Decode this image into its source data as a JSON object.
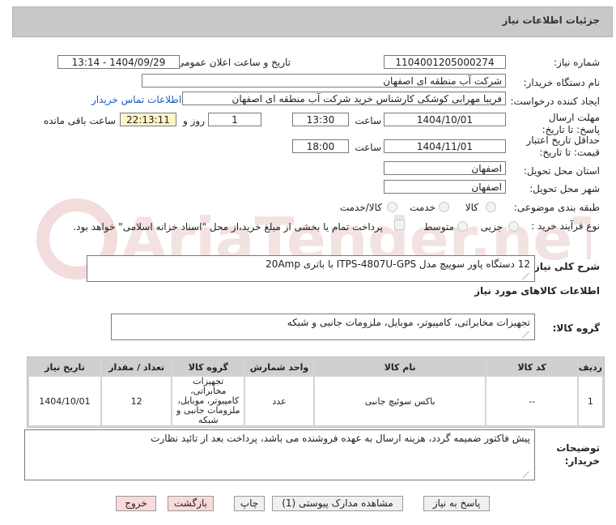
{
  "header": {
    "title": "جزئیات اطلاعات نیاز"
  },
  "fields": {
    "need_number_label": "شماره نیاز:",
    "need_number": "1104001205000274",
    "announce_label": "تاریخ و ساعت اعلان عمومی:",
    "announce_value": "1404/09/29 - 13:14",
    "buyer_org_label": "نام دستگاه خریدار:",
    "buyer_org": "شرکت آب منطقه ای اصفهان",
    "creator_label": "ایجاد کننده درخواست:",
    "creator": "فریبا مهرابی کوشکی کارشناس خرید شرکت آب منطقه ای اصفهان",
    "contact_link": "اطلاعات تماس خریدار",
    "deadline_label": "مهلت ارسال پاسخ: تا تاریخ:",
    "deadline_date": "1404/10/01",
    "time_word": "ساعت",
    "deadline_time": "13:30",
    "days_value": "1",
    "days_word": "روز و",
    "remaining_time": "22:13:11",
    "remaining_label": "ساعت باقی مانده",
    "validity_label": "حداقل تاریخ اعتبار قیمت: تا تاریخ:",
    "validity_date": "1404/11/01",
    "validity_time": "18:00",
    "province_label": "استان محل تحویل:",
    "province": "اصفهان",
    "city_label": "شهر محل تحویل:",
    "city": "اصفهان",
    "category_label": "طبقه بندی موضوعی:",
    "category_options": [
      "کالا",
      "خدمت",
      "کالا/خدمت"
    ],
    "process_label": "نوع فرآیند خرید :",
    "process_options": [
      "جزیی",
      "متوسط"
    ],
    "payment_note": "پرداخت تمام یا بخشی از مبلغ خرید،از محل \"اسناد خزانه اسلامی\" خواهد بود."
  },
  "summary": {
    "label": "شرح کلی نیاز:",
    "value": "12 دستگاه پاور سوییچ مدل ITPS-4807U-GPS با باتری 20Amp"
  },
  "goods_info_title": "اطلاعات کالاهای مورد نیاز",
  "goods_group": {
    "label": "گروه کالا:",
    "value": "تجهیزات مخابراتی، کامپیوتر، موبایل، ملزومات جانبی و شبکه"
  },
  "table": {
    "headers": [
      "ردیف",
      "کد کالا",
      "نام کالا",
      "واحد شمارش",
      "گروه کالا",
      "تعداد / مقدار",
      "تاریخ نیاز"
    ],
    "rows": [
      [
        "1",
        "--",
        "باکس سوئیچ جانبی",
        "عدد",
        "تجهیزات مخابراتی، کامپیوتر، موبایل، ملزومات جانبی و شبکه",
        "12",
        "1404/10/01"
      ]
    ]
  },
  "buyer_notes": {
    "label": "توضیحات خریدار:",
    "value": "پیش فاکتور ضمیمه گردد، هزینه ارسال به عهده فروشنده می باشد، پرداخت بعد از تائید نظارت"
  },
  "buttons": {
    "reply": "پاسخ به نیاز",
    "docs": "مشاهده مدارک پیوستی (1)",
    "print": "چاپ",
    "back": "بازگشت",
    "exit": "خروج"
  },
  "watermark": "AriaTender.neT"
}
